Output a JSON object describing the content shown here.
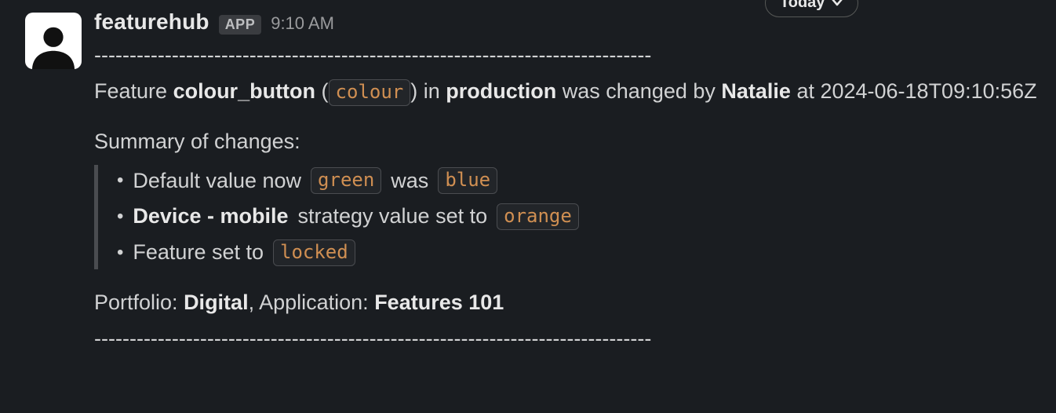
{
  "datePill": {
    "label": "Today"
  },
  "message": {
    "sender": "featurehub",
    "appBadge": "APP",
    "time": "9:10 AM",
    "dashes": "-------------------------------------------------------------------------------",
    "line1": {
      "pre": "Feature ",
      "feature": "colour_button",
      "openParen": " (",
      "typeCode": "colour",
      "closeParen": ") in ",
      "env": "production",
      "mid": " was changed by ",
      "user": "Natalie",
      "at": " at 2024-06-18T09:10:56Z"
    },
    "summaryTitle": "Summary of changes:",
    "changes": {
      "row1": {
        "a": "Default value now ",
        "code1": "green",
        "b": " was ",
        "code2": "blue"
      },
      "row2": {
        "strategy": "Device - mobile",
        "mid": " strategy value set to ",
        "code": "orange"
      },
      "row3": {
        "a": "Feature set to ",
        "code": "locked"
      }
    },
    "footer": {
      "portfolioLabel": "Portfolio: ",
      "portfolio": "Digital",
      "sep": ", Application: ",
      "application": "Features 101"
    }
  }
}
